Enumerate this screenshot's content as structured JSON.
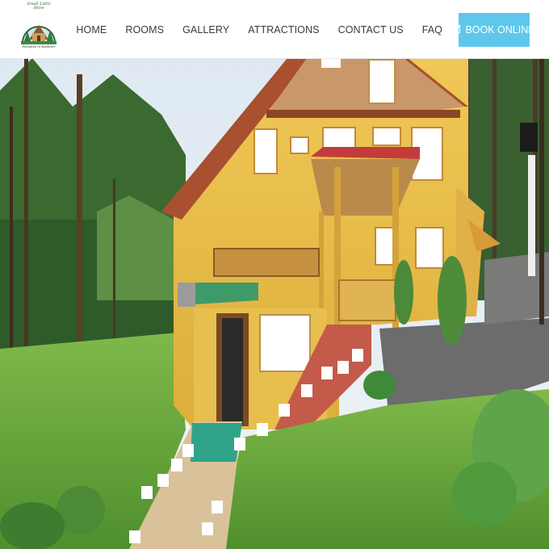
{
  "brand": {
    "logo_name": "Small Little Shire",
    "tagline": "Paradise in Kashmir"
  },
  "nav": {
    "items": [
      "HOME",
      "ROOMS",
      "GALLERY",
      "ATTRACTIONS",
      "CONTACT US",
      "FAQ"
    ],
    "book_label": "BOOK ONLINE"
  },
  "colors": {
    "accent": "#5ec8ec",
    "house_wall": "#e9c04e",
    "roof_trim": "#b4553a"
  },
  "hero": {
    "icon": "calendar-icon"
  }
}
